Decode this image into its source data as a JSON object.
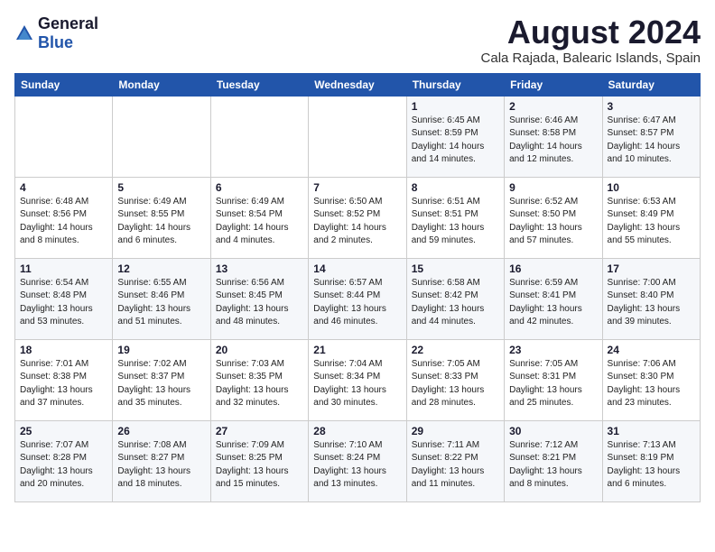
{
  "header": {
    "logo_general": "General",
    "logo_blue": "Blue",
    "month_title": "August 2024",
    "location": "Cala Rajada, Balearic Islands, Spain"
  },
  "days_of_week": [
    "Sunday",
    "Monday",
    "Tuesday",
    "Wednesday",
    "Thursday",
    "Friday",
    "Saturday"
  ],
  "weeks": [
    [
      {
        "day": "",
        "info": ""
      },
      {
        "day": "",
        "info": ""
      },
      {
        "day": "",
        "info": ""
      },
      {
        "day": "",
        "info": ""
      },
      {
        "day": "1",
        "info": "Sunrise: 6:45 AM\nSunset: 8:59 PM\nDaylight: 14 hours\nand 14 minutes."
      },
      {
        "day": "2",
        "info": "Sunrise: 6:46 AM\nSunset: 8:58 PM\nDaylight: 14 hours\nand 12 minutes."
      },
      {
        "day": "3",
        "info": "Sunrise: 6:47 AM\nSunset: 8:57 PM\nDaylight: 14 hours\nand 10 minutes."
      }
    ],
    [
      {
        "day": "4",
        "info": "Sunrise: 6:48 AM\nSunset: 8:56 PM\nDaylight: 14 hours\nand 8 minutes."
      },
      {
        "day": "5",
        "info": "Sunrise: 6:49 AM\nSunset: 8:55 PM\nDaylight: 14 hours\nand 6 minutes."
      },
      {
        "day": "6",
        "info": "Sunrise: 6:49 AM\nSunset: 8:54 PM\nDaylight: 14 hours\nand 4 minutes."
      },
      {
        "day": "7",
        "info": "Sunrise: 6:50 AM\nSunset: 8:52 PM\nDaylight: 14 hours\nand 2 minutes."
      },
      {
        "day": "8",
        "info": "Sunrise: 6:51 AM\nSunset: 8:51 PM\nDaylight: 13 hours\nand 59 minutes."
      },
      {
        "day": "9",
        "info": "Sunrise: 6:52 AM\nSunset: 8:50 PM\nDaylight: 13 hours\nand 57 minutes."
      },
      {
        "day": "10",
        "info": "Sunrise: 6:53 AM\nSunset: 8:49 PM\nDaylight: 13 hours\nand 55 minutes."
      }
    ],
    [
      {
        "day": "11",
        "info": "Sunrise: 6:54 AM\nSunset: 8:48 PM\nDaylight: 13 hours\nand 53 minutes."
      },
      {
        "day": "12",
        "info": "Sunrise: 6:55 AM\nSunset: 8:46 PM\nDaylight: 13 hours\nand 51 minutes."
      },
      {
        "day": "13",
        "info": "Sunrise: 6:56 AM\nSunset: 8:45 PM\nDaylight: 13 hours\nand 48 minutes."
      },
      {
        "day": "14",
        "info": "Sunrise: 6:57 AM\nSunset: 8:44 PM\nDaylight: 13 hours\nand 46 minutes."
      },
      {
        "day": "15",
        "info": "Sunrise: 6:58 AM\nSunset: 8:42 PM\nDaylight: 13 hours\nand 44 minutes."
      },
      {
        "day": "16",
        "info": "Sunrise: 6:59 AM\nSunset: 8:41 PM\nDaylight: 13 hours\nand 42 minutes."
      },
      {
        "day": "17",
        "info": "Sunrise: 7:00 AM\nSunset: 8:40 PM\nDaylight: 13 hours\nand 39 minutes."
      }
    ],
    [
      {
        "day": "18",
        "info": "Sunrise: 7:01 AM\nSunset: 8:38 PM\nDaylight: 13 hours\nand 37 minutes."
      },
      {
        "day": "19",
        "info": "Sunrise: 7:02 AM\nSunset: 8:37 PM\nDaylight: 13 hours\nand 35 minutes."
      },
      {
        "day": "20",
        "info": "Sunrise: 7:03 AM\nSunset: 8:35 PM\nDaylight: 13 hours\nand 32 minutes."
      },
      {
        "day": "21",
        "info": "Sunrise: 7:04 AM\nSunset: 8:34 PM\nDaylight: 13 hours\nand 30 minutes."
      },
      {
        "day": "22",
        "info": "Sunrise: 7:05 AM\nSunset: 8:33 PM\nDaylight: 13 hours\nand 28 minutes."
      },
      {
        "day": "23",
        "info": "Sunrise: 7:05 AM\nSunset: 8:31 PM\nDaylight: 13 hours\nand 25 minutes."
      },
      {
        "day": "24",
        "info": "Sunrise: 7:06 AM\nSunset: 8:30 PM\nDaylight: 13 hours\nand 23 minutes."
      }
    ],
    [
      {
        "day": "25",
        "info": "Sunrise: 7:07 AM\nSunset: 8:28 PM\nDaylight: 13 hours\nand 20 minutes."
      },
      {
        "day": "26",
        "info": "Sunrise: 7:08 AM\nSunset: 8:27 PM\nDaylight: 13 hours\nand 18 minutes."
      },
      {
        "day": "27",
        "info": "Sunrise: 7:09 AM\nSunset: 8:25 PM\nDaylight: 13 hours\nand 15 minutes."
      },
      {
        "day": "28",
        "info": "Sunrise: 7:10 AM\nSunset: 8:24 PM\nDaylight: 13 hours\nand 13 minutes."
      },
      {
        "day": "29",
        "info": "Sunrise: 7:11 AM\nSunset: 8:22 PM\nDaylight: 13 hours\nand 11 minutes."
      },
      {
        "day": "30",
        "info": "Sunrise: 7:12 AM\nSunset: 8:21 PM\nDaylight: 13 hours\nand 8 minutes."
      },
      {
        "day": "31",
        "info": "Sunrise: 7:13 AM\nSunset: 8:19 PM\nDaylight: 13 hours\nand 6 minutes."
      }
    ]
  ]
}
